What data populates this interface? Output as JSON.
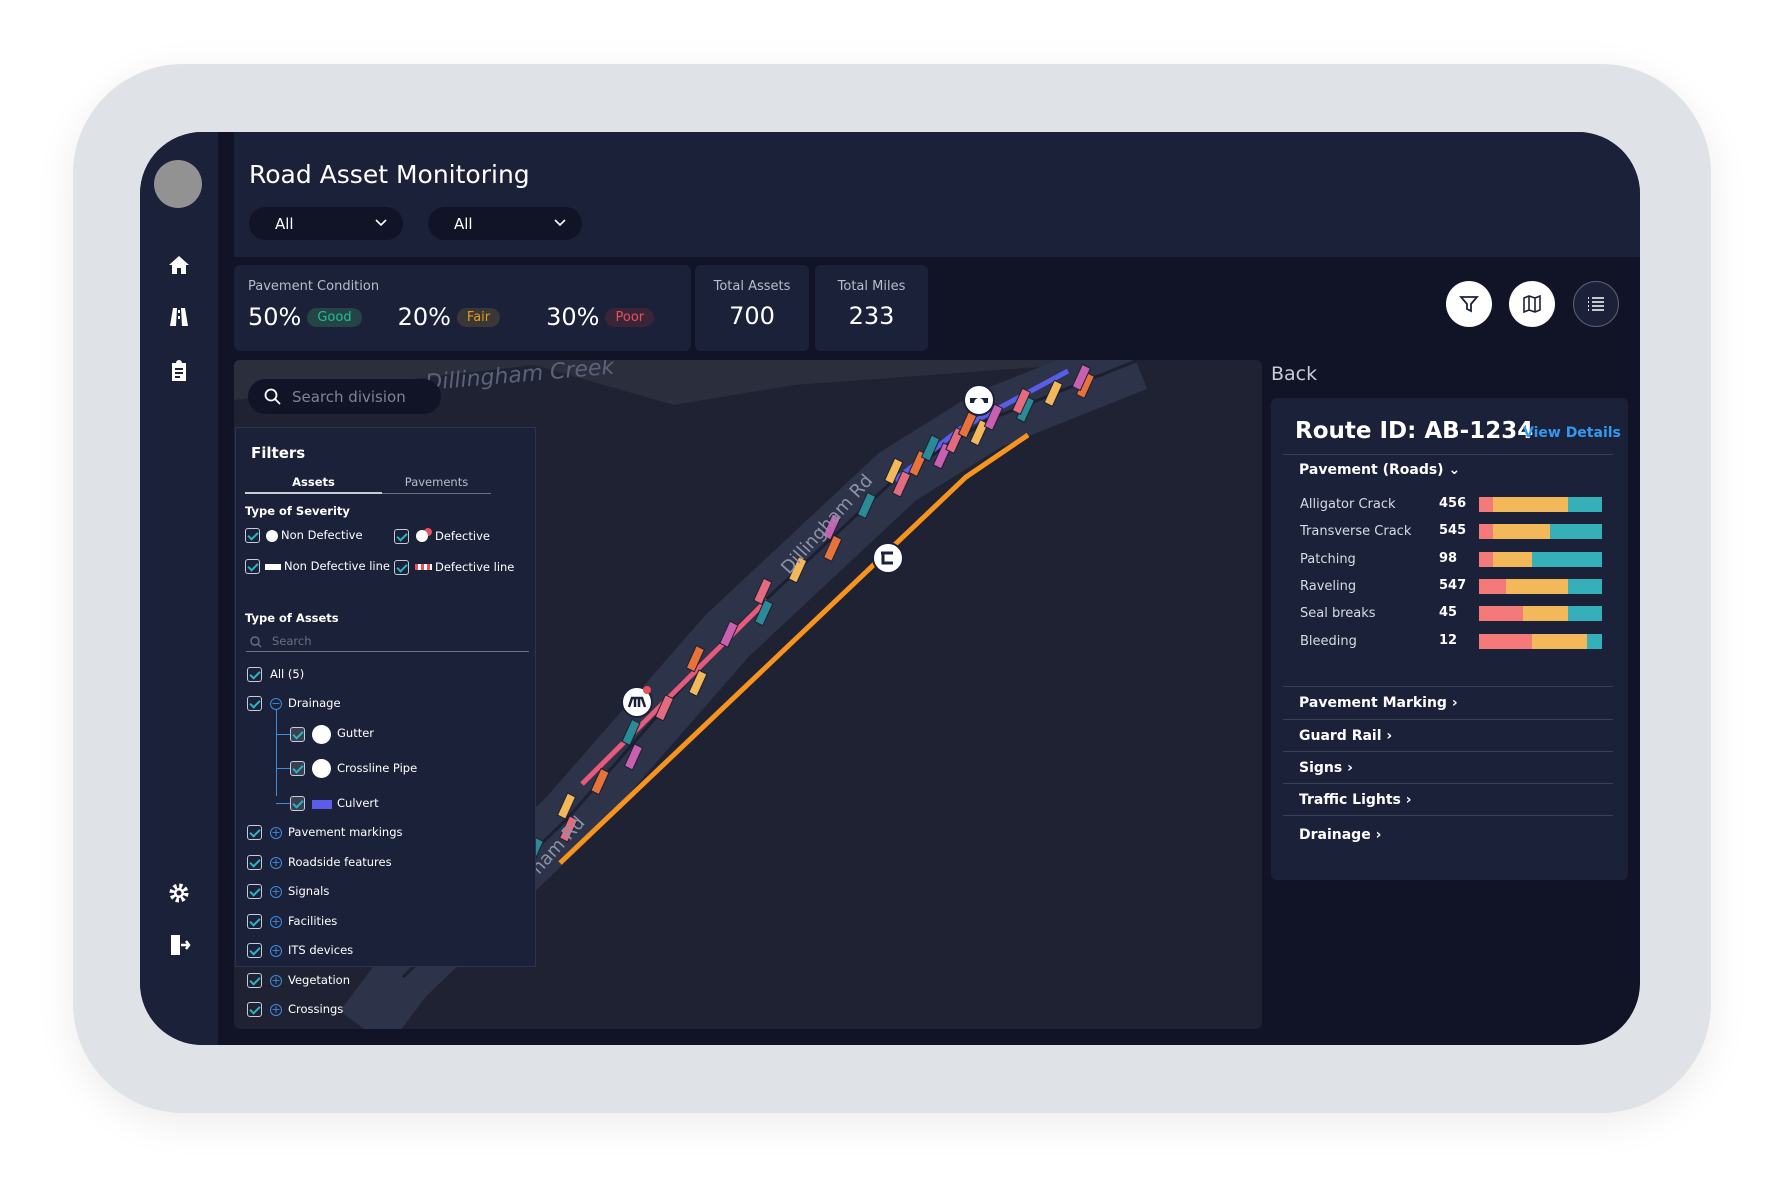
{
  "header": {
    "title": "Road Asset Monitoring",
    "dropdowns": [
      {
        "value": "All"
      },
      {
        "value": "All"
      }
    ]
  },
  "sidebar": {
    "items": [
      {
        "icon": "home-icon"
      },
      {
        "icon": "road-icon"
      },
      {
        "icon": "clipboard-icon"
      },
      {
        "icon": "gear-icon"
      },
      {
        "icon": "logout-icon"
      }
    ]
  },
  "stats": {
    "pavement_condition": {
      "label": "Pavement Condition",
      "items": [
        {
          "value": "50%",
          "status": "Good",
          "color": "#1fbf96"
        },
        {
          "value": "20%",
          "status": "Fair",
          "color": "#e49a1b"
        },
        {
          "value": "30%",
          "status": "Poor",
          "color": "#e8505b"
        }
      ]
    },
    "total_assets": {
      "label": "Total Assets",
      "value": "700"
    },
    "total_miles": {
      "label": "Total Miles",
      "value": "233"
    }
  },
  "toolbar": {
    "buttons": [
      "filter-icon",
      "map-icon",
      "list-icon"
    ]
  },
  "map": {
    "search_placeholder": "Search division",
    "creek_label": "Dillingham Creek",
    "road_label": "Dillingham Rd",
    "road_label_2": "ham Rd",
    "colors": {
      "culvert": "#5b5ce8",
      "gutter_line": "#f7931e",
      "defective_line": "#e85a7a"
    }
  },
  "filters": {
    "title": "Filters",
    "tabs": [
      {
        "label": "Assets",
        "active": true
      },
      {
        "label": "Pavements",
        "active": false
      }
    ],
    "severity_title": "Type of Severity",
    "severity": [
      {
        "label": "Non Defective",
        "checked": true
      },
      {
        "label": "Defective",
        "checked": true
      },
      {
        "label": "Non Defective line",
        "checked": true
      },
      {
        "label": "Defective line",
        "checked": true
      }
    ],
    "assets_title": "Type of Assets",
    "assets_search_placeholder": "Search",
    "all_label": "All (5)",
    "drainage": {
      "label": "Drainage",
      "children": [
        {
          "label": "Gutter"
        },
        {
          "label": "Crossline Pipe"
        },
        {
          "label": "Culvert"
        }
      ]
    },
    "others": [
      {
        "label": "Pavement markings"
      },
      {
        "label": "Roadside features"
      },
      {
        "label": "Signals"
      },
      {
        "label": "Facilities"
      },
      {
        "label": "ITS devices"
      },
      {
        "label": "Vegetation"
      },
      {
        "label": "Crossings"
      }
    ]
  },
  "detail": {
    "back_label": "Back",
    "route_id": "Route ID: AB-1234",
    "view_details": "View Details",
    "pavement_section": "Pavement (Roads)",
    "bar_colors": [
      "#f47a7a",
      "#f2b85a",
      "#36b0b8"
    ],
    "rows": [
      {
        "name": "Alligator Crack",
        "count": "456",
        "split": [
          11,
          61,
          28
        ]
      },
      {
        "name": "Transverse Crack",
        "count": "545",
        "split": [
          11,
          47,
          42
        ]
      },
      {
        "name": "Patching",
        "count": "98",
        "split": [
          11,
          32,
          57
        ]
      },
      {
        "name": "Raveling",
        "count": "547",
        "split": [
          22,
          50,
          28
        ]
      },
      {
        "name": "Seal breaks",
        "count": "45",
        "split": [
          36,
          36,
          28
        ]
      },
      {
        "name": "Bleeding",
        "count": "12",
        "split": [
          43,
          45,
          12
        ]
      }
    ],
    "sections": [
      {
        "label": "Pavement Marking"
      },
      {
        "label": "Guard Rail"
      },
      {
        "label": "Signs"
      },
      {
        "label": "Traffic Lights"
      },
      {
        "label": "Drainage"
      }
    ]
  },
  "zoom": {
    "plus": "+",
    "minus": "−",
    "level": 0.15
  }
}
